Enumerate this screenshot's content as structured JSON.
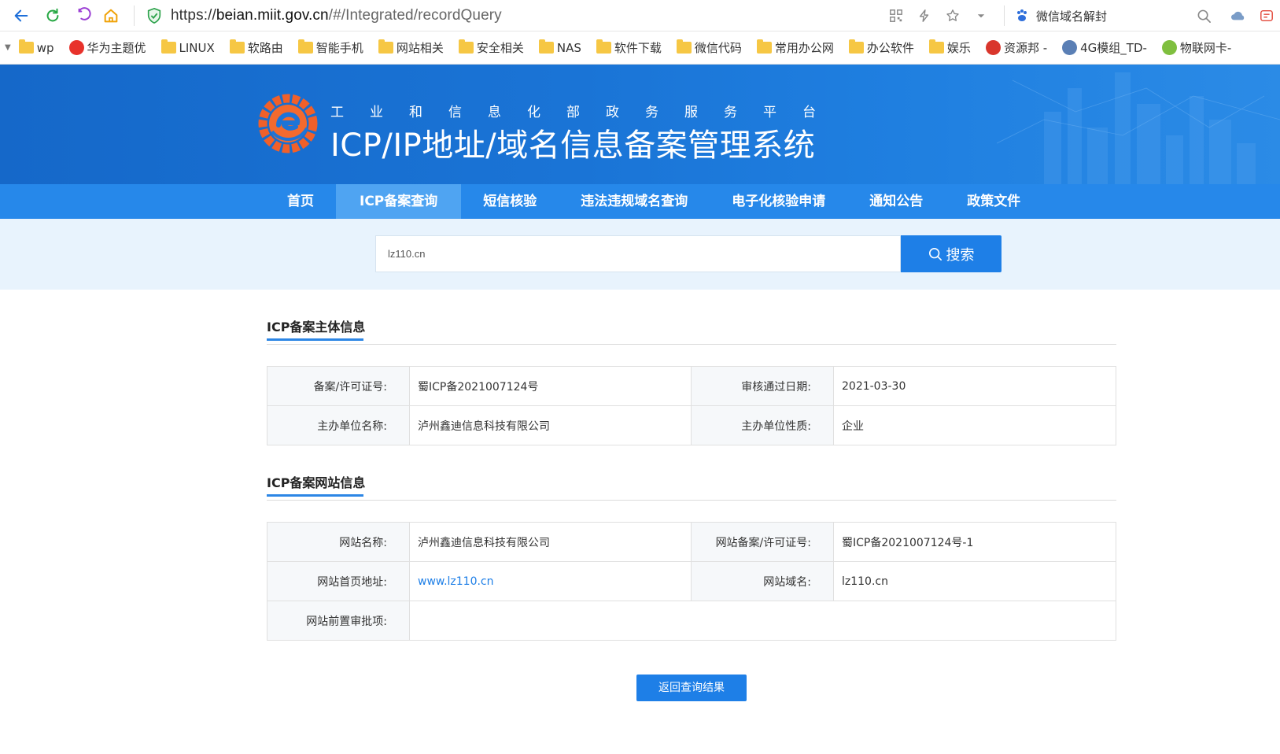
{
  "browser": {
    "url_scheme": "https://",
    "url_host": "beian.miit.gov.cn",
    "url_path": "/#/Integrated/recordQuery",
    "search_hint": "微信域名解封"
  },
  "bookmarks": [
    {
      "label": "wp",
      "type": "folder"
    },
    {
      "label": "华为主题优",
      "type": "site",
      "color": "#e8322b"
    },
    {
      "label": "LINUX",
      "type": "folder"
    },
    {
      "label": "软路由",
      "type": "folder"
    },
    {
      "label": "智能手机",
      "type": "folder"
    },
    {
      "label": "网站相关",
      "type": "folder"
    },
    {
      "label": "安全相关",
      "type": "folder"
    },
    {
      "label": "NAS",
      "type": "folder"
    },
    {
      "label": "软件下载",
      "type": "folder"
    },
    {
      "label": "微信代码",
      "type": "folder"
    },
    {
      "label": "常用办公网",
      "type": "folder"
    },
    {
      "label": "办公软件",
      "type": "folder"
    },
    {
      "label": "娱乐",
      "type": "folder"
    },
    {
      "label": "资源邦 -",
      "type": "site",
      "color": "#d9362c"
    },
    {
      "label": "4G模组_TD-",
      "type": "site",
      "color": "#5a7fb5"
    },
    {
      "label": "物联网卡-",
      "type": "site",
      "color": "#7fbf3f"
    }
  ],
  "banner": {
    "subtitle": "工业和信息化部政务服务平台",
    "title": "ICP/IP地址/域名信息备案管理系统"
  },
  "nav": {
    "items": [
      {
        "label": "首页"
      },
      {
        "label": "ICP备案查询"
      },
      {
        "label": "短信核验"
      },
      {
        "label": "违法违规域名查询"
      },
      {
        "label": "电子化核验申请"
      },
      {
        "label": "通知公告"
      },
      {
        "label": "政策文件"
      }
    ],
    "active_index": 1
  },
  "search": {
    "value": "lz110.cn",
    "button_label": "搜索"
  },
  "subject": {
    "title": "ICP备案主体信息",
    "license_label": "备案/许可证号:",
    "license_value": "蜀ICP备2021007124号",
    "date_label": "审核通过日期:",
    "date_value": "2021-03-30",
    "org_label": "主办单位名称:",
    "org_value": "泸州鑫迪信息科技有限公司",
    "nature_label": "主办单位性质:",
    "nature_value": "企业"
  },
  "website": {
    "title": "ICP备案网站信息",
    "name_label": "网站名称:",
    "name_value": "泸州鑫迪信息科技有限公司",
    "license_label": "网站备案/许可证号:",
    "license_value": "蜀ICP备2021007124号-1",
    "home_label": "网站首页地址:",
    "home_value": "www.lz110.cn",
    "domain_label": "网站域名:",
    "domain_value": "lz110.cn",
    "preapproval_label": "网站前置审批项:",
    "preapproval_value": ""
  },
  "back_button_label": "返回查询结果",
  "colors": {
    "primary": "#1e7fe7",
    "nav": "#2688ea",
    "nav_active": "#4fa4f2",
    "banner": "#1a74d6"
  }
}
